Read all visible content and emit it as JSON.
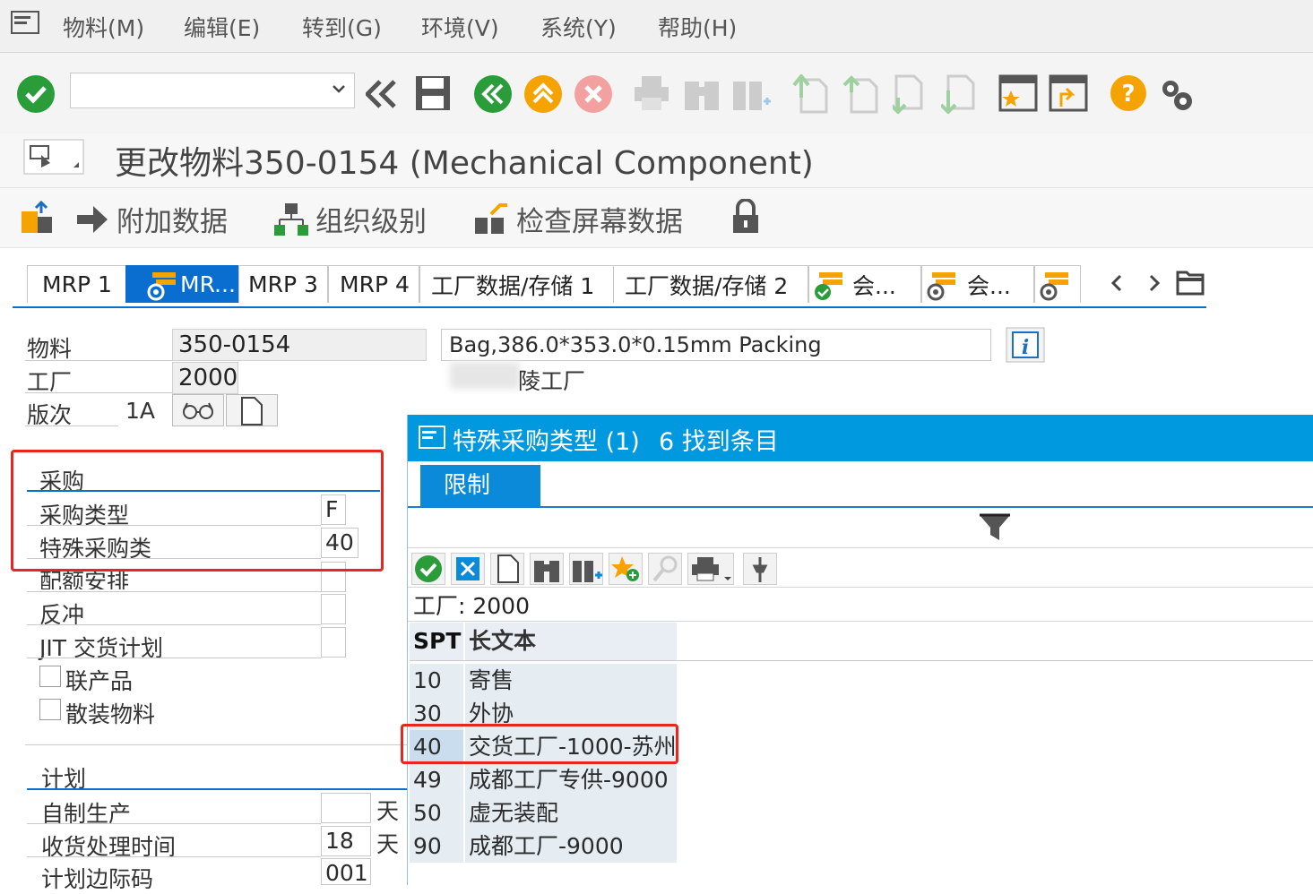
{
  "menu": {
    "items": [
      "物料(M)",
      "编辑(E)",
      "转到(G)",
      "环境(V)",
      "系统(Y)",
      "帮助(H)"
    ]
  },
  "toolbar": {
    "command_value": "",
    "icons": [
      "enter-icon",
      "dropdown-icon",
      "back-double-icon",
      "save-icon",
      "back-icon",
      "exit-icon",
      "cancel-icon",
      "print-icon",
      "find-icon",
      "find-next-icon",
      "first-page-icon",
      "prev-page-icon",
      "next-page-icon",
      "last-page-icon",
      "new-session-icon",
      "shortcut-icon",
      "help-icon",
      "settings-icon"
    ]
  },
  "title": "更改物料350-0154 (Mechanical Component)",
  "app_toolbar": {
    "additional_data": "附加数据",
    "org_levels": "组织级别",
    "check_screen_data": "检查屏幕数据"
  },
  "tabs": [
    "MRP 1",
    "MR...",
    "MRP 3",
    "MRP 4",
    "工厂数据/存储 1",
    "工厂数据/存储 2",
    "会...",
    "会..."
  ],
  "header": {
    "material_label": "物料",
    "material_value": "350-0154",
    "material_desc": "Bag,386.0*353.0*0.15mm Packing",
    "plant_label": "工厂",
    "plant_value": "2000",
    "plant_desc": "陵工厂",
    "version_label": "版次",
    "version_value": "1A"
  },
  "procurement": {
    "group_title": "采购",
    "proc_type_label": "采购类型",
    "proc_type_value": "F",
    "special_proc_label": "特殊采购类",
    "special_proc_value": "40",
    "quota_label": "配额安排",
    "backflush_label": "反冲",
    "jit_label": "JIT 交货计划",
    "coproduct_label": "联产品",
    "bulk_label": "散装物料"
  },
  "planning": {
    "group_title": "计划",
    "inhouse_label": "自制生产",
    "inhouse_unit": "天",
    "gr_time_label": "收货处理时间",
    "gr_time_value": "18",
    "gr_time_unit": "天",
    "margin_key_label": "计划边际码",
    "margin_key_value": "001"
  },
  "popup": {
    "title": "特殊采购类型 (1)",
    "found": "6 找到条目",
    "restrict_tab": "限制",
    "plant_filter": "工厂: 2000",
    "col_code": "SPT",
    "col_text": "长文本",
    "rows": [
      {
        "code": "10",
        "text": "寄售"
      },
      {
        "code": "30",
        "text": "外协"
      },
      {
        "code": "40",
        "text": "交货工厂-1000-苏州"
      },
      {
        "code": "49",
        "text": "成都工厂专供-9000"
      },
      {
        "code": "50",
        "text": "虚无装配"
      },
      {
        "code": "90",
        "text": "成都工厂-9000"
      }
    ]
  },
  "colors": {
    "accent": "#0a6ed1",
    "popup_title": "#0099e0",
    "highlight": "#e8251f"
  }
}
